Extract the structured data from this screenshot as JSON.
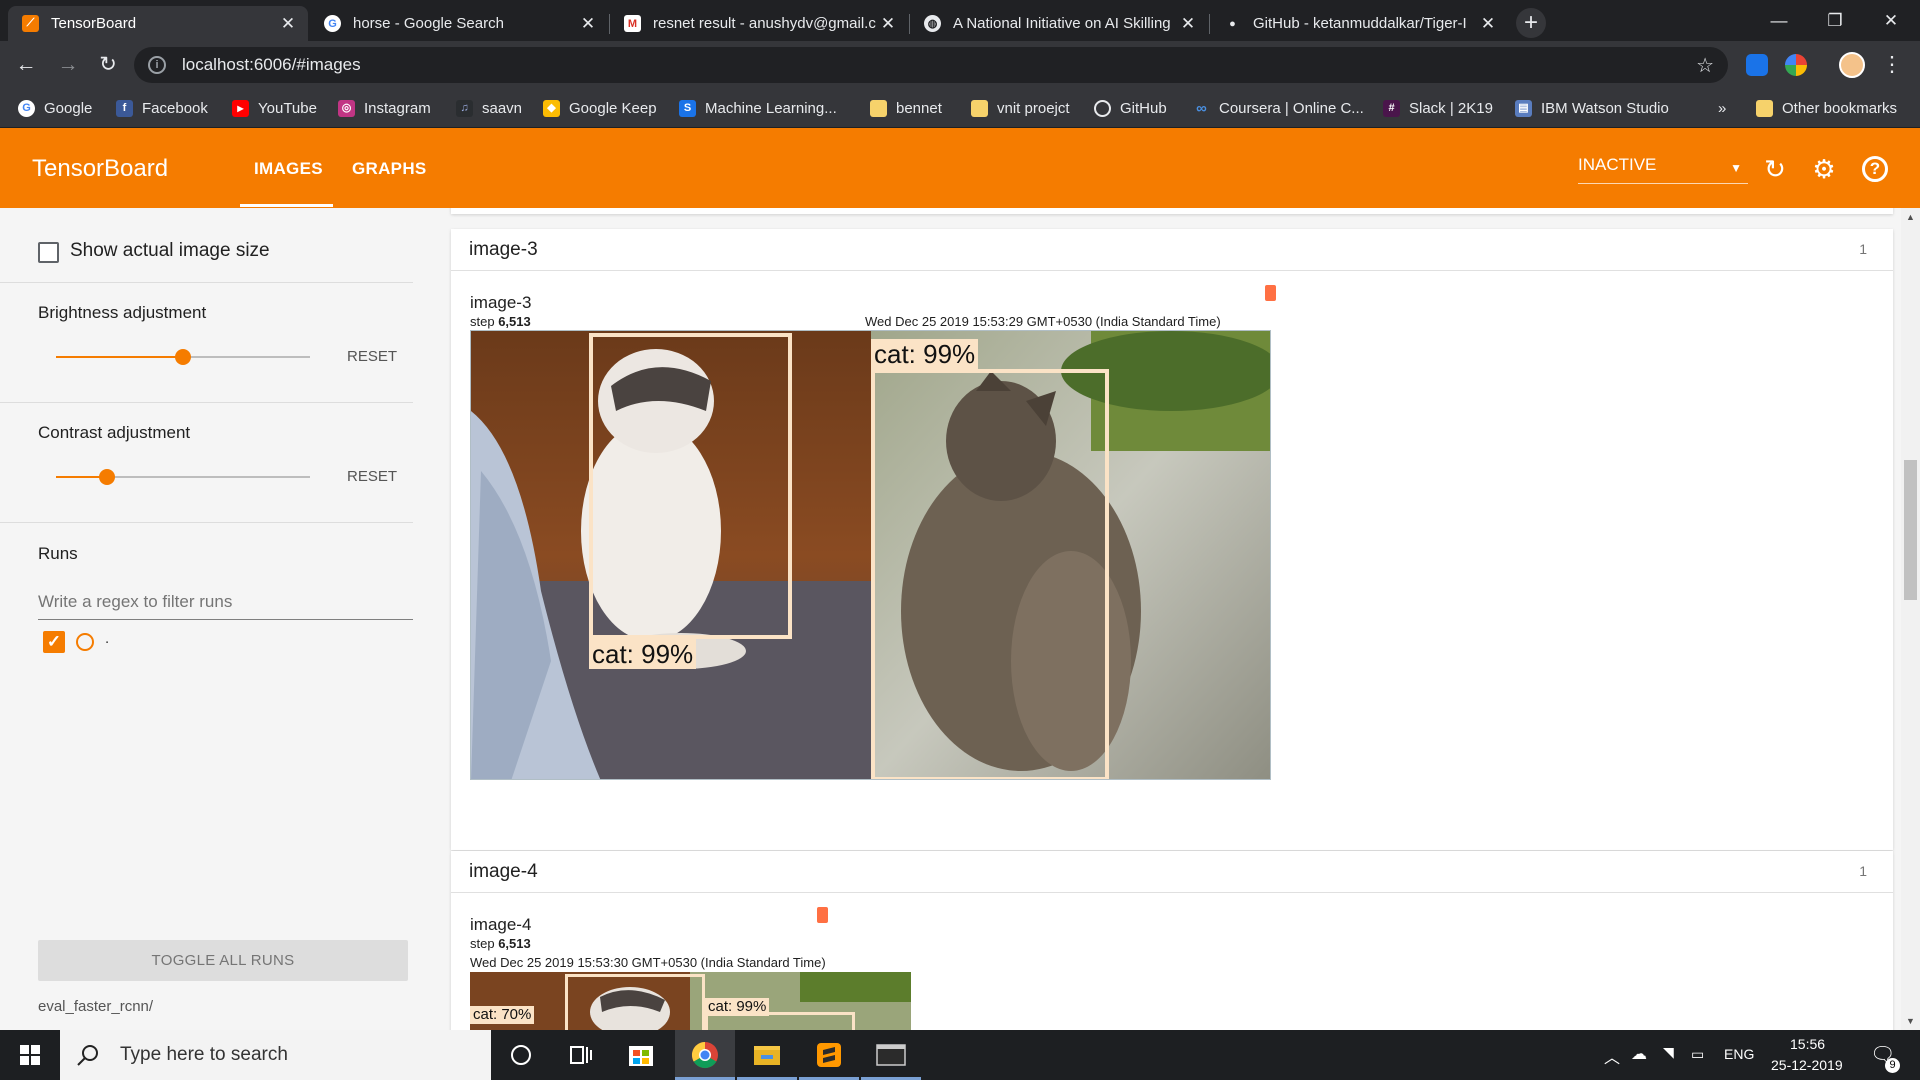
{
  "browser": {
    "tabs": [
      {
        "title": "TensorBoard",
        "active": true
      },
      {
        "title": "horse - Google Search",
        "active": false
      },
      {
        "title": "resnet result - anushydv@gmail.c",
        "active": false
      },
      {
        "title": "A National Initiative on AI Skilling",
        "active": false
      },
      {
        "title": "GitHub - ketanmuddalkar/Tiger-I",
        "active": false
      }
    ],
    "url": "localhost:6006/#images",
    "bookmarks": [
      {
        "label": "Google",
        "icon": "google-icon"
      },
      {
        "label": "Facebook",
        "icon": "facebook-icon"
      },
      {
        "label": "YouTube",
        "icon": "youtube-icon"
      },
      {
        "label": "Instagram",
        "icon": "instagram-icon"
      },
      {
        "label": "saavn",
        "icon": "saavn-icon"
      },
      {
        "label": "Google Keep",
        "icon": "keep-icon"
      },
      {
        "label": "Machine Learning...",
        "icon": "scribd-icon"
      },
      {
        "label": "bennet",
        "icon": "folder-icon"
      },
      {
        "label": "vnit proejct",
        "icon": "folder-icon"
      },
      {
        "label": "GitHub",
        "icon": "github-icon"
      },
      {
        "label": "Coursera | Online C...",
        "icon": "coursera-icon"
      },
      {
        "label": "Slack | 2K19",
        "icon": "slack-icon"
      },
      {
        "label": "IBM Watson Studio",
        "icon": "ibm-icon"
      }
    ],
    "bookmarks_overflow": "»",
    "other_bookmarks": "Other bookmarks"
  },
  "tensorboard": {
    "title": "TensorBoard",
    "nav_tabs": [
      "IMAGES",
      "GRAPHS"
    ],
    "status": "INACTIVE",
    "accent": "#f57c00"
  },
  "sidebar": {
    "show_actual_size": "Show actual image size",
    "brightness_label": "Brightness adjustment",
    "brightness_level": 0.5,
    "contrast_label": "Contrast adjustment",
    "contrast_level": 0.2,
    "reset": "RESET",
    "runs_title": "Runs",
    "runs_filter_placeholder": "Write a regex to filter runs",
    "run_name": ".",
    "toggle_all": "TOGGLE ALL RUNS",
    "logdir": "eval_faster_rcnn/"
  },
  "cards": [
    {
      "header": "image-3",
      "count": "1",
      "image_title": "image-3",
      "step_prefix": "step",
      "step": "6,513",
      "wall_time": "Wed Dec 25 2019 15:53:29 GMT+0530 (India Standard Time)",
      "detections": [
        "cat: 99%",
        "cat: 99%"
      ]
    },
    {
      "header": "image-4",
      "count": "1",
      "image_title": "image-4",
      "step_prefix": "step",
      "step": "6,513",
      "wall_time": "Wed Dec 25 2019 15:53:30 GMT+0530 (India Standard Time)",
      "detections": [
        "cat: 70%",
        "cat: 99%"
      ]
    }
  ],
  "taskbar": {
    "search_placeholder": "Type here to search",
    "lang": "ENG",
    "time": "15:56",
    "date": "25-12-2019",
    "notifications": "9"
  }
}
